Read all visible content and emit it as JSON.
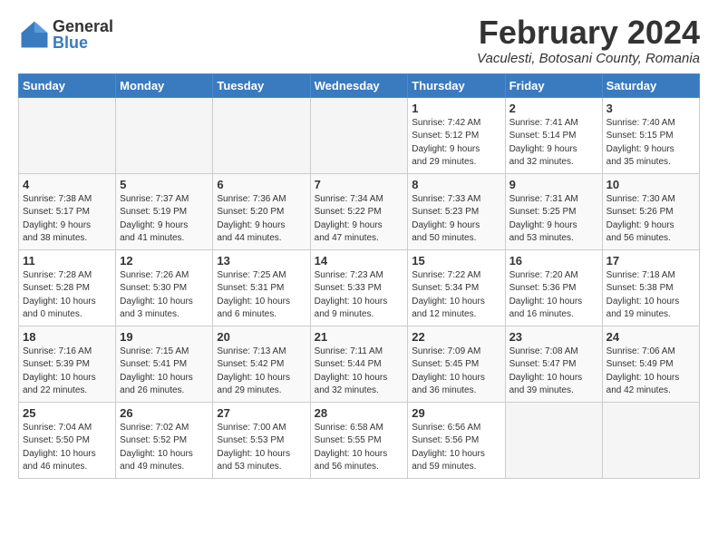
{
  "logo": {
    "general": "General",
    "blue": "Blue"
  },
  "header": {
    "title": "February 2024",
    "subtitle": "Vaculesti, Botosani County, Romania"
  },
  "weekdays": [
    "Sunday",
    "Monday",
    "Tuesday",
    "Wednesday",
    "Thursday",
    "Friday",
    "Saturday"
  ],
  "weeks": [
    [
      {
        "day": "",
        "info": ""
      },
      {
        "day": "",
        "info": ""
      },
      {
        "day": "",
        "info": ""
      },
      {
        "day": "",
        "info": ""
      },
      {
        "day": "1",
        "info": "Sunrise: 7:42 AM\nSunset: 5:12 PM\nDaylight: 9 hours\nand 29 minutes."
      },
      {
        "day": "2",
        "info": "Sunrise: 7:41 AM\nSunset: 5:14 PM\nDaylight: 9 hours\nand 32 minutes."
      },
      {
        "day": "3",
        "info": "Sunrise: 7:40 AM\nSunset: 5:15 PM\nDaylight: 9 hours\nand 35 minutes."
      }
    ],
    [
      {
        "day": "4",
        "info": "Sunrise: 7:38 AM\nSunset: 5:17 PM\nDaylight: 9 hours\nand 38 minutes."
      },
      {
        "day": "5",
        "info": "Sunrise: 7:37 AM\nSunset: 5:19 PM\nDaylight: 9 hours\nand 41 minutes."
      },
      {
        "day": "6",
        "info": "Sunrise: 7:36 AM\nSunset: 5:20 PM\nDaylight: 9 hours\nand 44 minutes."
      },
      {
        "day": "7",
        "info": "Sunrise: 7:34 AM\nSunset: 5:22 PM\nDaylight: 9 hours\nand 47 minutes."
      },
      {
        "day": "8",
        "info": "Sunrise: 7:33 AM\nSunset: 5:23 PM\nDaylight: 9 hours\nand 50 minutes."
      },
      {
        "day": "9",
        "info": "Sunrise: 7:31 AM\nSunset: 5:25 PM\nDaylight: 9 hours\nand 53 minutes."
      },
      {
        "day": "10",
        "info": "Sunrise: 7:30 AM\nSunset: 5:26 PM\nDaylight: 9 hours\nand 56 minutes."
      }
    ],
    [
      {
        "day": "11",
        "info": "Sunrise: 7:28 AM\nSunset: 5:28 PM\nDaylight: 10 hours\nand 0 minutes."
      },
      {
        "day": "12",
        "info": "Sunrise: 7:26 AM\nSunset: 5:30 PM\nDaylight: 10 hours\nand 3 minutes."
      },
      {
        "day": "13",
        "info": "Sunrise: 7:25 AM\nSunset: 5:31 PM\nDaylight: 10 hours\nand 6 minutes."
      },
      {
        "day": "14",
        "info": "Sunrise: 7:23 AM\nSunset: 5:33 PM\nDaylight: 10 hours\nand 9 minutes."
      },
      {
        "day": "15",
        "info": "Sunrise: 7:22 AM\nSunset: 5:34 PM\nDaylight: 10 hours\nand 12 minutes."
      },
      {
        "day": "16",
        "info": "Sunrise: 7:20 AM\nSunset: 5:36 PM\nDaylight: 10 hours\nand 16 minutes."
      },
      {
        "day": "17",
        "info": "Sunrise: 7:18 AM\nSunset: 5:38 PM\nDaylight: 10 hours\nand 19 minutes."
      }
    ],
    [
      {
        "day": "18",
        "info": "Sunrise: 7:16 AM\nSunset: 5:39 PM\nDaylight: 10 hours\nand 22 minutes."
      },
      {
        "day": "19",
        "info": "Sunrise: 7:15 AM\nSunset: 5:41 PM\nDaylight: 10 hours\nand 26 minutes."
      },
      {
        "day": "20",
        "info": "Sunrise: 7:13 AM\nSunset: 5:42 PM\nDaylight: 10 hours\nand 29 minutes."
      },
      {
        "day": "21",
        "info": "Sunrise: 7:11 AM\nSunset: 5:44 PM\nDaylight: 10 hours\nand 32 minutes."
      },
      {
        "day": "22",
        "info": "Sunrise: 7:09 AM\nSunset: 5:45 PM\nDaylight: 10 hours\nand 36 minutes."
      },
      {
        "day": "23",
        "info": "Sunrise: 7:08 AM\nSunset: 5:47 PM\nDaylight: 10 hours\nand 39 minutes."
      },
      {
        "day": "24",
        "info": "Sunrise: 7:06 AM\nSunset: 5:49 PM\nDaylight: 10 hours\nand 42 minutes."
      }
    ],
    [
      {
        "day": "25",
        "info": "Sunrise: 7:04 AM\nSunset: 5:50 PM\nDaylight: 10 hours\nand 46 minutes."
      },
      {
        "day": "26",
        "info": "Sunrise: 7:02 AM\nSunset: 5:52 PM\nDaylight: 10 hours\nand 49 minutes."
      },
      {
        "day": "27",
        "info": "Sunrise: 7:00 AM\nSunset: 5:53 PM\nDaylight: 10 hours\nand 53 minutes."
      },
      {
        "day": "28",
        "info": "Sunrise: 6:58 AM\nSunset: 5:55 PM\nDaylight: 10 hours\nand 56 minutes."
      },
      {
        "day": "29",
        "info": "Sunrise: 6:56 AM\nSunset: 5:56 PM\nDaylight: 10 hours\nand 59 minutes."
      },
      {
        "day": "",
        "info": ""
      },
      {
        "day": "",
        "info": ""
      }
    ]
  ]
}
